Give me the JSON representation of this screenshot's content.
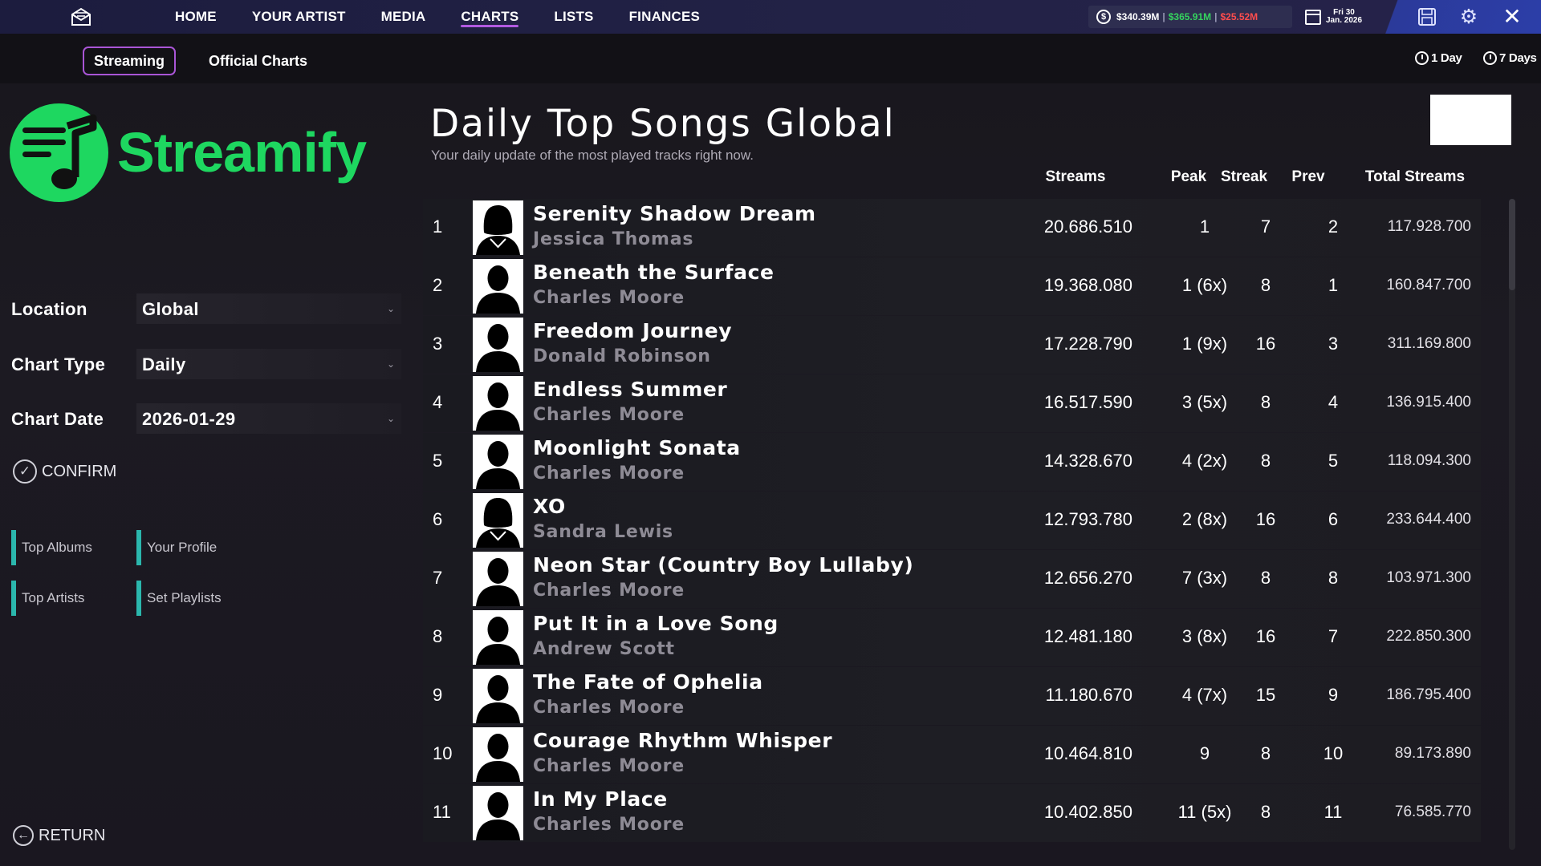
{
  "topbar": {
    "nav": [
      "HOME",
      "YOUR ARTIST",
      "MEDIA",
      "CHARTS",
      "LISTS",
      "FINANCES"
    ],
    "active_nav": "CHARTS",
    "money": {
      "balance": "$340.39M",
      "income": "$365.91M",
      "expense": "$25.52M",
      "separator": "|"
    },
    "date": {
      "day": "Fri 30",
      "month_year": "Jan. 2026"
    },
    "icons": [
      "mail-icon",
      "calendar-icon",
      "save-icon",
      "gear-icon",
      "close-icon"
    ]
  },
  "subbar": {
    "tabs": [
      "Streaming",
      "Official Charts"
    ],
    "active_tab": "Streaming",
    "period_1": "1 Day",
    "period_7": "7 Days"
  },
  "brand": {
    "name": "Streamify",
    "color": "#1ed760"
  },
  "filters": {
    "location_label": "Location",
    "location_value": "Global",
    "type_label": "Chart Type",
    "type_value": "Daily",
    "date_label": "Chart Date",
    "date_value": "2026-01-29",
    "confirm": "CONFIRM"
  },
  "links": [
    "Top Albums",
    "Your Profile",
    "Top Artists",
    "Set Playlists"
  ],
  "return_label": "RETURN",
  "chart": {
    "title": "Daily Top Songs Global",
    "subtitle": "Your daily update of the most played tracks right now.",
    "columns": {
      "streams": "Streams",
      "peak": "Peak",
      "streak": "Streak",
      "prev": "Prev",
      "total": "Total Streams"
    },
    "rows": [
      {
        "rank": "1",
        "song": "Serenity Shadow Dream",
        "artist": "Jessica Thomas",
        "streams": "20.686.510",
        "peak": "1",
        "streak": "7",
        "prev": "2",
        "total": "117.928.700",
        "avatar": "female"
      },
      {
        "rank": "2",
        "song": "Beneath the Surface",
        "artist": "Charles Moore",
        "streams": "19.368.080",
        "peak": "1 (6x)",
        "streak": "8",
        "prev": "1",
        "total": "160.847.700",
        "avatar": "male"
      },
      {
        "rank": "3",
        "song": "Freedom Journey",
        "artist": "Donald Robinson",
        "streams": "17.228.790",
        "peak": "1 (9x)",
        "streak": "16",
        "prev": "3",
        "total": "311.169.800",
        "avatar": "male"
      },
      {
        "rank": "4",
        "song": "Endless Summer",
        "artist": "Charles Moore",
        "streams": "16.517.590",
        "peak": "3 (5x)",
        "streak": "8",
        "prev": "4",
        "total": "136.915.400",
        "avatar": "male"
      },
      {
        "rank": "5",
        "song": "Moonlight Sonata",
        "artist": "Charles Moore",
        "streams": "14.328.670",
        "peak": "4 (2x)",
        "streak": "8",
        "prev": "5",
        "total": "118.094.300",
        "avatar": "male"
      },
      {
        "rank": "6",
        "song": "XO",
        "artist": "Sandra Lewis",
        "streams": "12.793.780",
        "peak": "2 (8x)",
        "streak": "16",
        "prev": "6",
        "total": "233.644.400",
        "avatar": "female"
      },
      {
        "rank": "7",
        "song": "Neon Star (Country Boy Lullaby)",
        "artist": "Charles Moore",
        "streams": "12.656.270",
        "peak": "7 (3x)",
        "streak": "8",
        "prev": "8",
        "total": "103.971.300",
        "avatar": "male"
      },
      {
        "rank": "8",
        "song": "Put It in a Love Song",
        "artist": "Andrew Scott",
        "streams": "12.481.180",
        "peak": "3 (8x)",
        "streak": "16",
        "prev": "7",
        "total": "222.850.300",
        "avatar": "male"
      },
      {
        "rank": "9",
        "song": "The Fate of Ophelia",
        "artist": "Charles Moore",
        "streams": "11.180.670",
        "peak": "4 (7x)",
        "streak": "15",
        "prev": "9",
        "total": "186.795.400",
        "avatar": "male"
      },
      {
        "rank": "10",
        "song": "Courage Rhythm Whisper",
        "artist": "Charles Moore",
        "streams": "10.464.810",
        "peak": "9",
        "streak": "8",
        "prev": "10",
        "total": "89.173.890",
        "avatar": "male"
      },
      {
        "rank": "11",
        "song": "In My Place",
        "artist": "Charles Moore",
        "streams": "10.402.850",
        "peak": "11 (5x)",
        "streak": "8",
        "prev": "11",
        "total": "76.585.770",
        "avatar": "male"
      }
    ]
  }
}
